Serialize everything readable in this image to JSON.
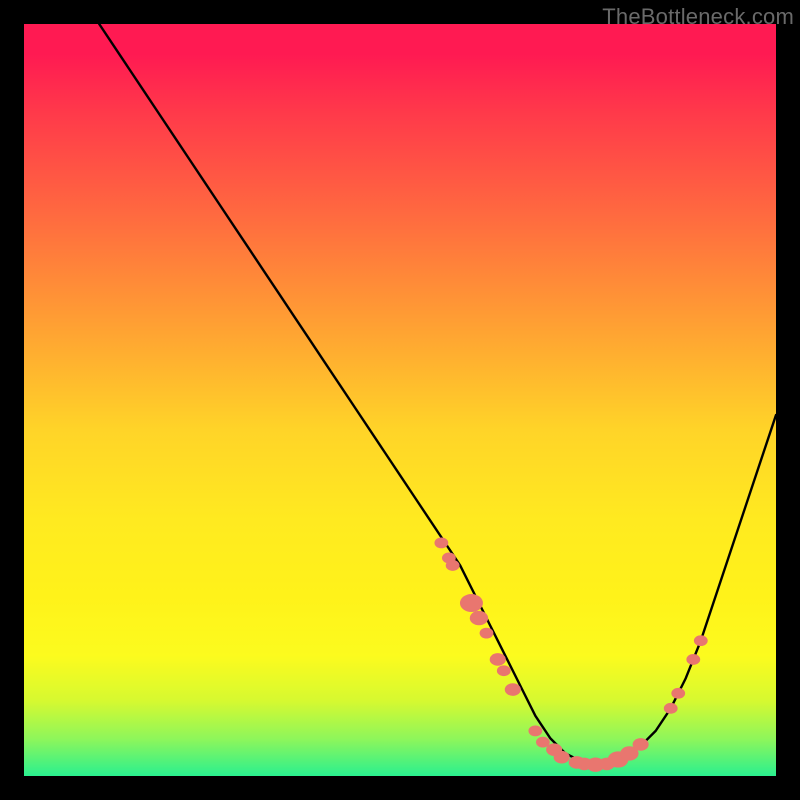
{
  "watermark": "TheBottleneck.com",
  "colors": {
    "background": "#000000",
    "gradient_top": "#ff1a52",
    "gradient_bottom": "#2af08f",
    "curve": "#000000",
    "marker": "#e9766f"
  },
  "chart_data": {
    "type": "line",
    "title": "",
    "xlabel": "",
    "ylabel": "",
    "xlim": [
      0,
      100
    ],
    "ylim": [
      0,
      100
    ],
    "x": [
      10,
      12,
      14,
      16,
      18,
      20,
      22,
      24,
      26,
      28,
      30,
      32,
      34,
      36,
      38,
      40,
      42,
      44,
      46,
      48,
      50,
      52,
      54,
      56,
      58,
      60,
      62,
      64,
      66,
      68,
      70,
      72,
      74,
      76,
      78,
      80,
      82,
      84,
      86,
      88,
      90,
      92,
      94,
      96,
      98,
      100
    ],
    "values": [
      100,
      97,
      94,
      91,
      88,
      85,
      82,
      79,
      76,
      73,
      70,
      67,
      64,
      61,
      58,
      55,
      52,
      49,
      46,
      43,
      40,
      37,
      34,
      31,
      28,
      24,
      20,
      16,
      12,
      8,
      5,
      3,
      2,
      1.5,
      1.5,
      2.5,
      4,
      6,
      9,
      13,
      18,
      24,
      30,
      36,
      42,
      48
    ],
    "highlighted_points": [
      {
        "x": 55.5,
        "y": 31,
        "r": 6
      },
      {
        "x": 56.5,
        "y": 29,
        "r": 6
      },
      {
        "x": 57.0,
        "y": 28,
        "r": 6
      },
      {
        "x": 59.5,
        "y": 23,
        "r": 10
      },
      {
        "x": 60.5,
        "y": 21,
        "r": 8
      },
      {
        "x": 61.5,
        "y": 19,
        "r": 6
      },
      {
        "x": 63.0,
        "y": 15.5,
        "r": 7
      },
      {
        "x": 63.8,
        "y": 14,
        "r": 6
      },
      {
        "x": 65.0,
        "y": 11.5,
        "r": 7
      },
      {
        "x": 68.0,
        "y": 6,
        "r": 6
      },
      {
        "x": 69.0,
        "y": 4.5,
        "r": 6
      },
      {
        "x": 70.5,
        "y": 3.5,
        "r": 7
      },
      {
        "x": 71.5,
        "y": 2.5,
        "r": 7
      },
      {
        "x": 73.5,
        "y": 1.8,
        "r": 7
      },
      {
        "x": 74.5,
        "y": 1.6,
        "r": 7
      },
      {
        "x": 76.0,
        "y": 1.5,
        "r": 8
      },
      {
        "x": 77.5,
        "y": 1.6,
        "r": 7
      },
      {
        "x": 79.0,
        "y": 2.2,
        "r": 9
      },
      {
        "x": 80.5,
        "y": 3.0,
        "r": 8
      },
      {
        "x": 82.0,
        "y": 4.2,
        "r": 7
      },
      {
        "x": 86.0,
        "y": 9.0,
        "r": 6
      },
      {
        "x": 87.0,
        "y": 11.0,
        "r": 6
      },
      {
        "x": 89.0,
        "y": 15.5,
        "r": 6
      },
      {
        "x": 90.0,
        "y": 18.0,
        "r": 6
      }
    ]
  }
}
